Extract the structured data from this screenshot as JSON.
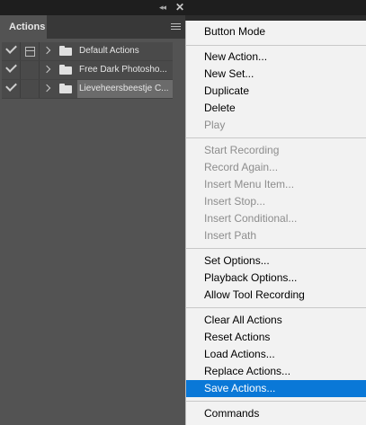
{
  "panel": {
    "tab_label": "Actions",
    "collapse_glyph": "◂◂",
    "close_glyph": "✕",
    "actions": [
      {
        "name": "Default Actions",
        "checked": true,
        "dialog_icon": true,
        "selected": false
      },
      {
        "name": "Free Dark Photosho...",
        "checked": true,
        "dialog_icon": false,
        "selected": false
      },
      {
        "name": "Lieveheersbeestje C...",
        "checked": true,
        "dialog_icon": false,
        "selected": true
      }
    ]
  },
  "menu": {
    "items": [
      {
        "label": "Button Mode",
        "enabled": true
      },
      {
        "label": "New Action...",
        "enabled": true
      },
      {
        "label": "New Set...",
        "enabled": true
      },
      {
        "label": "Duplicate",
        "enabled": true
      },
      {
        "label": "Delete",
        "enabled": true
      },
      {
        "label": "Play",
        "enabled": false
      },
      {
        "label": "Start Recording",
        "enabled": false
      },
      {
        "label": "Record Again...",
        "enabled": false
      },
      {
        "label": "Insert Menu Item...",
        "enabled": false
      },
      {
        "label": "Insert Stop...",
        "enabled": false
      },
      {
        "label": "Insert Conditional...",
        "enabled": false
      },
      {
        "label": "Insert Path",
        "enabled": false
      },
      {
        "label": "Set Options...",
        "enabled": true
      },
      {
        "label": "Playback Options...",
        "enabled": true
      },
      {
        "label": "Allow Tool Recording",
        "enabled": true
      },
      {
        "label": "Clear All Actions",
        "enabled": true
      },
      {
        "label": "Reset Actions",
        "enabled": true
      },
      {
        "label": "Load Actions...",
        "enabled": true
      },
      {
        "label": "Replace Actions...",
        "enabled": true
      },
      {
        "label": "Save Actions...",
        "enabled": true,
        "highlighted": true
      },
      {
        "label": "Commands",
        "enabled": true
      }
    ]
  },
  "colors": {
    "panel_bg": "#535353",
    "menu_bg": "#f2f2f2",
    "menu_highlight": "#0a78d7",
    "disabled_text": "#8d8d8d"
  }
}
